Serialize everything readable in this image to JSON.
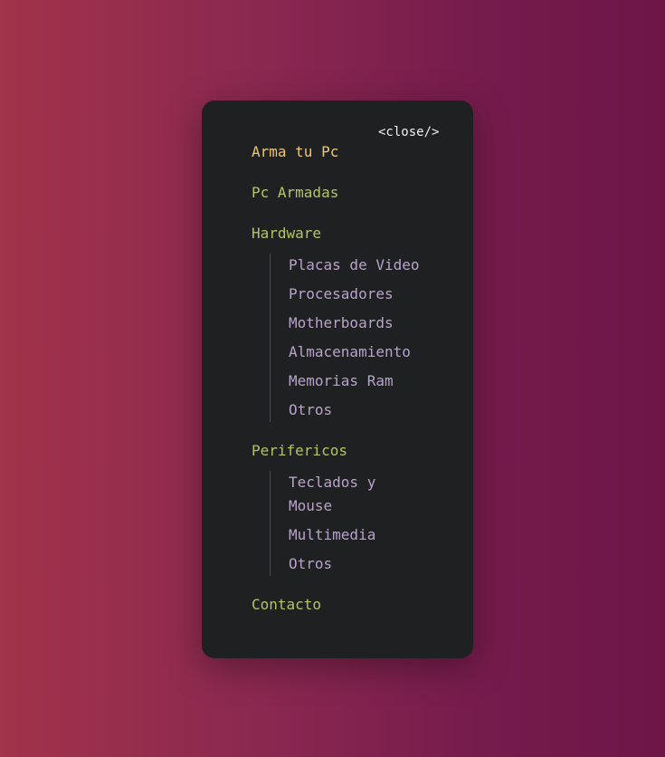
{
  "menu": {
    "close_label": "<close/>",
    "items": [
      {
        "label": "Arma tu Pc"
      },
      {
        "label": "Pc Armadas"
      },
      {
        "label": "Hardware",
        "children": [
          {
            "label": "Placas de Video"
          },
          {
            "label": "Procesadores"
          },
          {
            "label": "Motherboards"
          },
          {
            "label": "Almacenamiento"
          },
          {
            "label": "Memorias Ram"
          },
          {
            "label": "Otros"
          }
        ]
      },
      {
        "label": "Perifericos",
        "children": [
          {
            "label": "Teclados y Mouse"
          },
          {
            "label": "Multimedia"
          },
          {
            "label": "Otros"
          }
        ]
      },
      {
        "label": "Contacto"
      }
    ]
  },
  "colors": {
    "panel_background": "#1f2022",
    "active_item": "#f0c774",
    "top_item": "#b3c465",
    "sub_item": "#b9a2cb",
    "close_text": "#f1f1f1"
  }
}
